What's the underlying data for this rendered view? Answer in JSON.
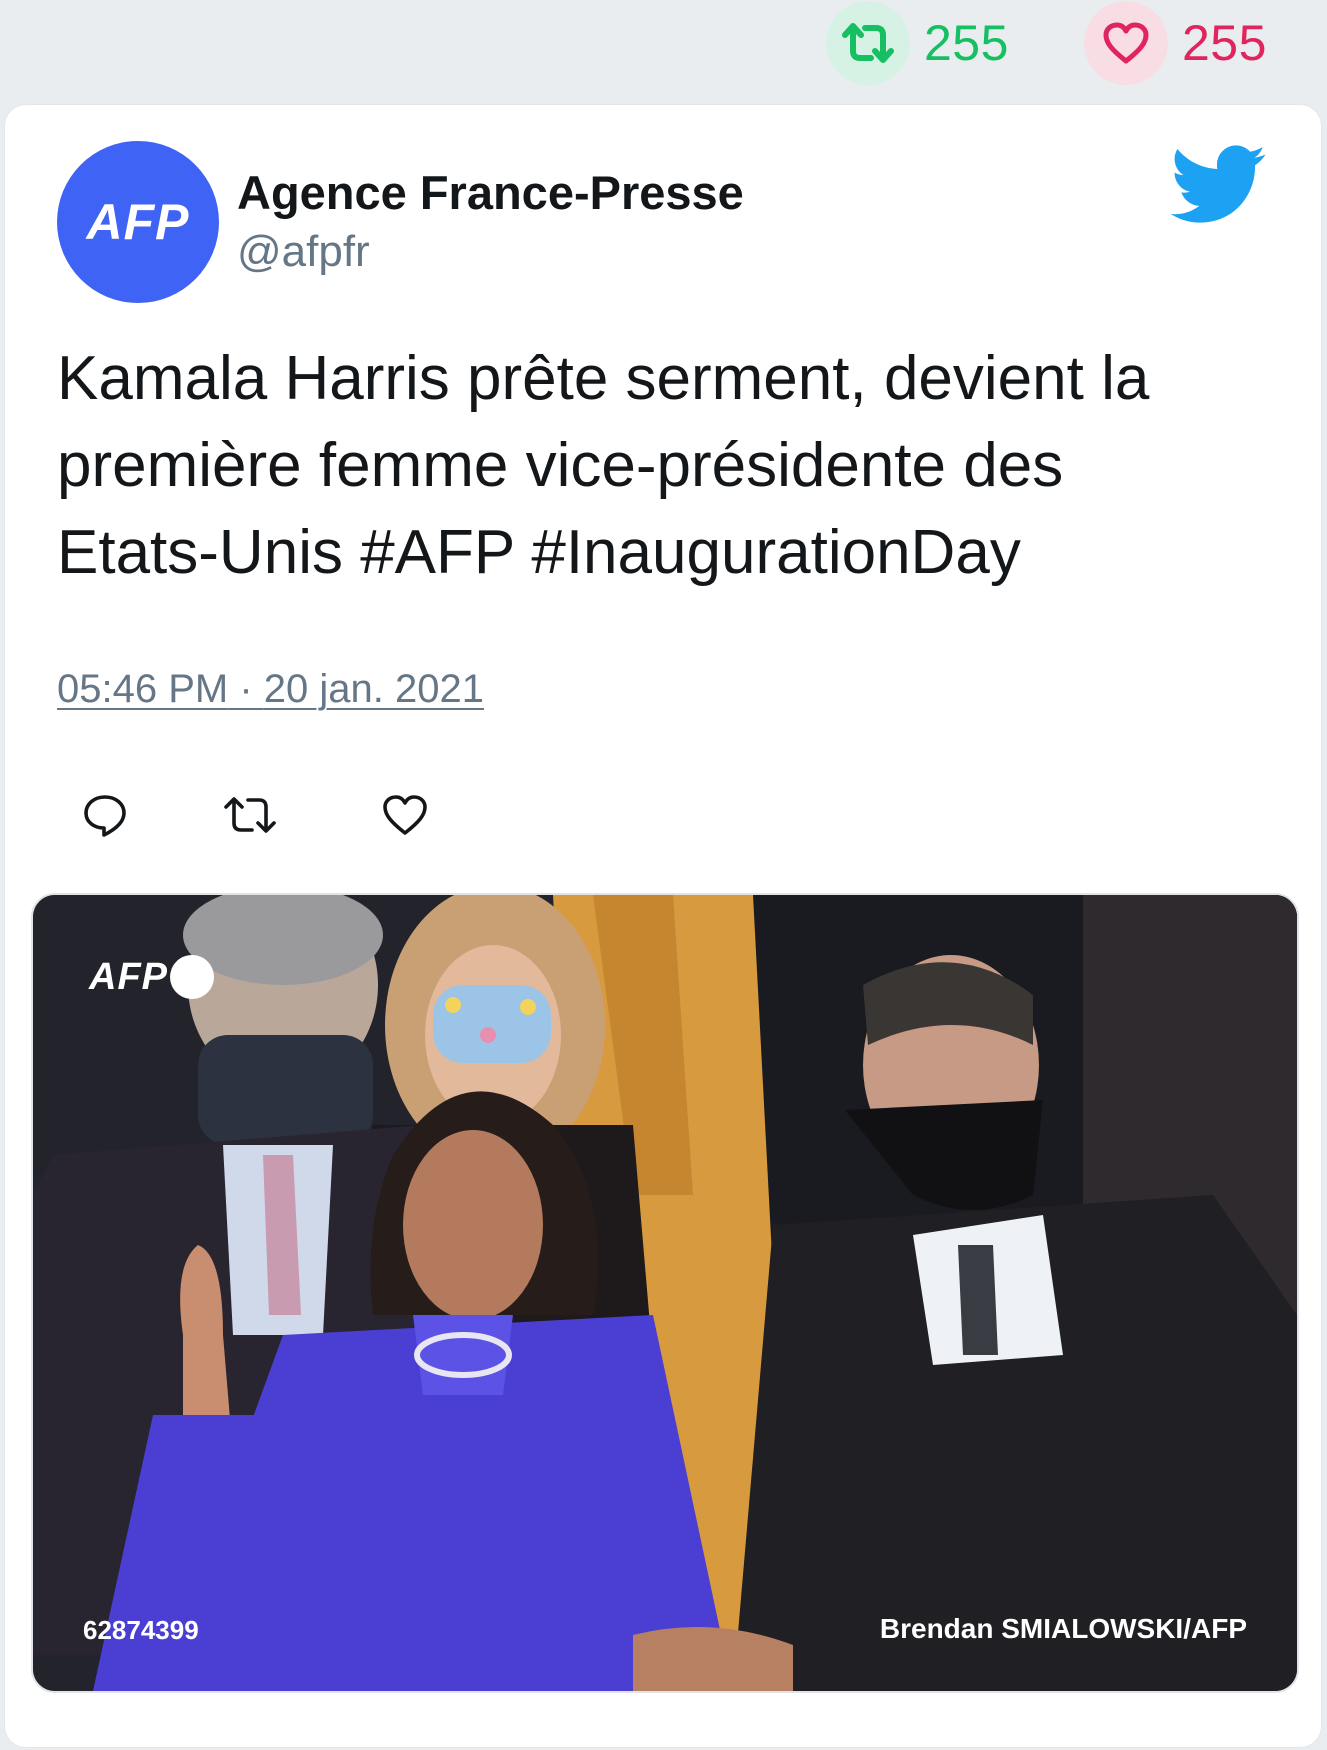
{
  "top_stats": {
    "retweets": "255",
    "likes": "255",
    "colors": {
      "retweet": "#17bf63",
      "like": "#e0245e"
    }
  },
  "tweet": {
    "avatar_text": "AFP",
    "author_name": "Agence France-Presse",
    "author_handle": "@afpfr",
    "text": "Kamala Harris prête serment, devient la\npremière femme vice-présidente des\nEtats-Unis #AFP #InaugurationDay",
    "time": "05:46 PM",
    "separator": " · ",
    "date": "20 jan. 2021",
    "platform_icon": "twitter-bird-icon",
    "actions": [
      "reply-icon",
      "retweet-icon",
      "like-icon"
    ],
    "brand_color": "#1da1f2",
    "avatar_color": "#3f63f5"
  },
  "media": {
    "watermark_logo": "AFP",
    "photo_id": "62874399",
    "credit": "Brendan SMIALOWSKI/AFP"
  }
}
